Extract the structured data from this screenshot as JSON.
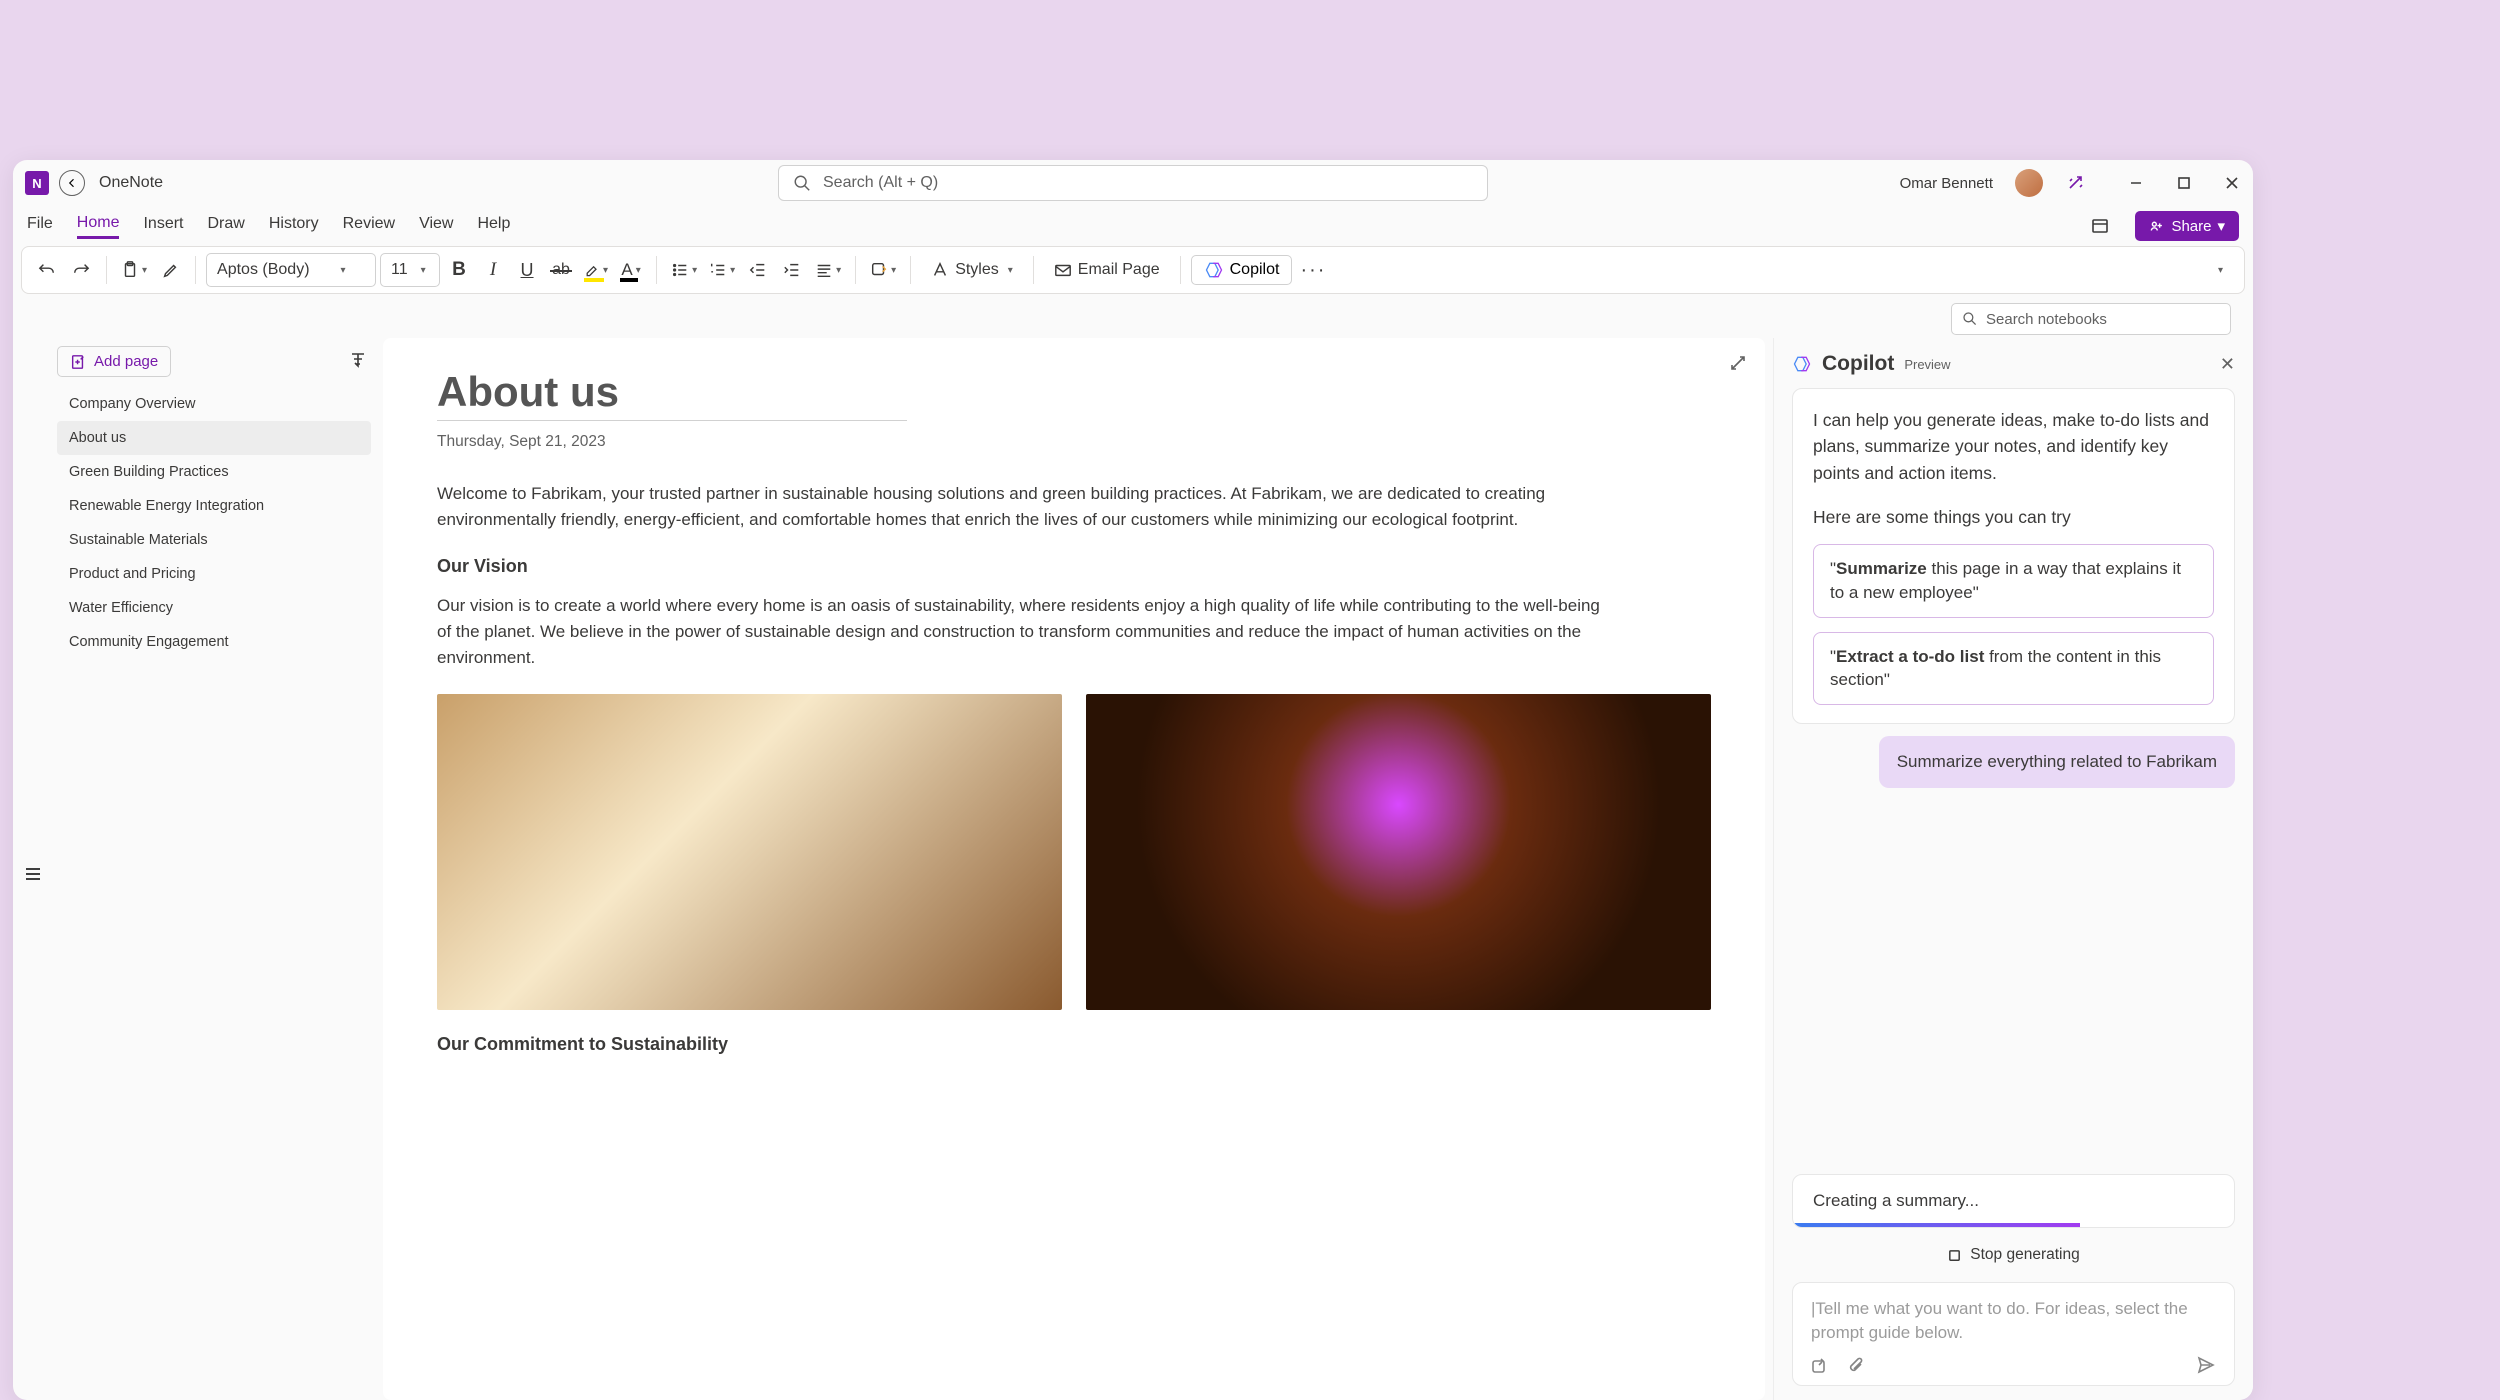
{
  "app": {
    "name": "OneNote"
  },
  "search": {
    "placeholder": "Search (Alt + Q)"
  },
  "user": {
    "name": "Omar Bennett"
  },
  "menubar": {
    "tabs": [
      "File",
      "Home",
      "Insert",
      "Draw",
      "History",
      "Review",
      "View",
      "Help"
    ],
    "active": 1,
    "share": "Share"
  },
  "toolbar": {
    "font": "Aptos (Body)",
    "size": "11",
    "styles": "Styles",
    "emailPage": "Email Page",
    "copilot": "Copilot"
  },
  "notebookSearch": {
    "placeholder": "Search notebooks"
  },
  "sidebar": {
    "addPage": "Add page",
    "pages": [
      "Company Overview",
      "About us",
      "Green Building Practices",
      "Renewable Energy Integration",
      "Sustainable Materials",
      "Product and Pricing",
      "Water Efficiency",
      "Community Engagement"
    ],
    "active": 1
  },
  "page": {
    "title": "About us",
    "date": "Thursday, Sept 21, 2023",
    "para1": "Welcome to Fabrikam, your trusted partner in sustainable housing solutions and green building practices. At Fabrikam, we are dedicated to creating environmentally friendly, energy-efficient, and comfortable homes that enrich the lives of our customers while minimizing our ecological footprint.",
    "heading1": "Our Vision",
    "para2": "Our vision is to create a world where every home is an oasis of sustainability, where residents enjoy a high quality of life while contributing to the well-being of the planet. We believe in the power of sustainable design and construction to transform communities and reduce the impact of human activities on the environment.",
    "heading2": "Our Commitment to Sustainability"
  },
  "copilot": {
    "title": "Copilot",
    "badge": "Preview",
    "intro": "I can help you generate ideas, make to-do lists and plans, summarize your notes, and identify key points and action items.",
    "introSubtitle": "Here are some things you can try",
    "suggestion1_bold": "Summarize",
    "suggestion1_rest": " this page in a way that explains it to a new employee\"",
    "suggestion2_bold": "Extract a to-do list",
    "suggestion2_rest": " from the content in this section\"",
    "userMsg": "Summarize everything related to Fabrikam",
    "status": "Creating a summary...",
    "stop": "Stop generating",
    "inputPlaceholder": "|Tell me what you want to do. For ideas, select the prompt guide below."
  }
}
